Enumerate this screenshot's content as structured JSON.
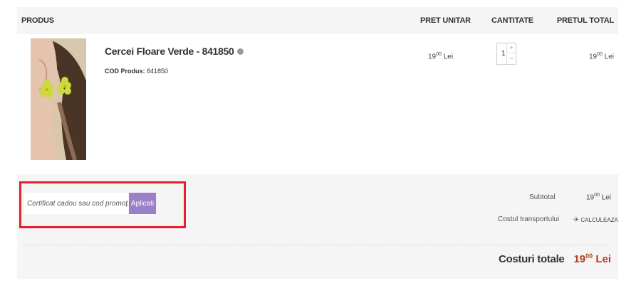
{
  "table_header": {
    "produs": "PRODUS",
    "pret_unitar": "PRET UNITAR",
    "cantitate": "CANTITATE",
    "pretul_total": "PRETUL TOTAL"
  },
  "product": {
    "name": "Cercei Floare Verde - 841850",
    "code_label": "COD Produs:",
    "code_value": "841850",
    "unit_price_int": "19",
    "unit_price_dec": "00",
    "currency": "Lei",
    "quantity": "1",
    "total_int": "19",
    "total_dec": "00"
  },
  "promo": {
    "placeholder": "Certificat cadou sau cod promoțional",
    "button_label": "Aplicati"
  },
  "summary": {
    "subtotal_label": "Subtotal",
    "subtotal_int": "19",
    "subtotal_dec": "00",
    "currency": "Lei",
    "shipping_label": "Costul transportului",
    "shipping_link": "CALCULEAZA",
    "total_label": "Costuri totale",
    "total_int": "19",
    "total_dec": "00",
    "total_currency": "Lei"
  },
  "colors": {
    "promo_button": "#9b7fc9",
    "total_price": "#c0391b",
    "highlight_border": "#e2202f"
  },
  "icons": {
    "info": "info-icon",
    "shipping": "plane-icon",
    "qty_increase": "plus-icon",
    "qty_decrease": "minus-icon"
  }
}
